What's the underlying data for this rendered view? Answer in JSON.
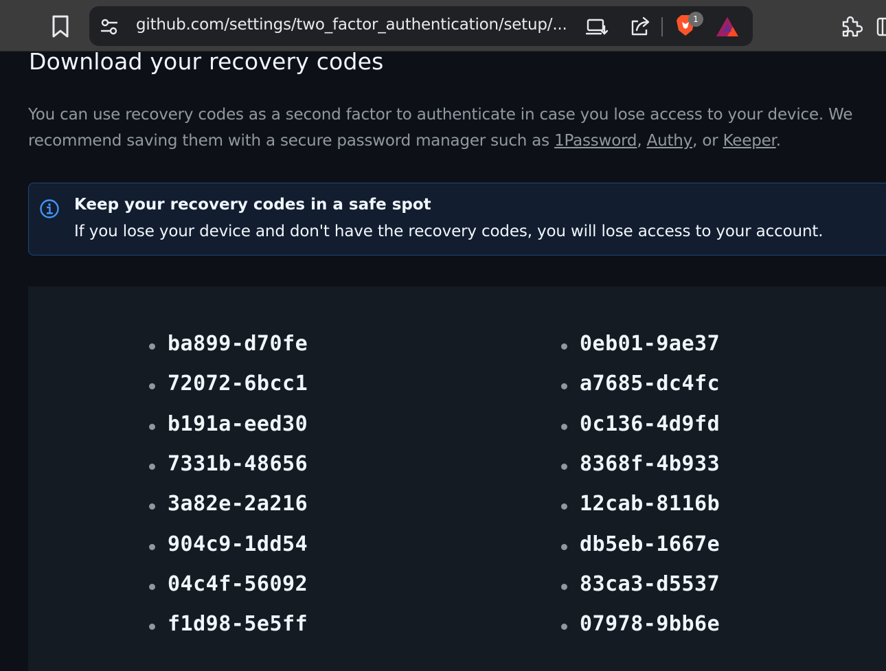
{
  "browser": {
    "url": "github.com/settings/two_factor_authentication/setup/...",
    "brave_badge_count": "1"
  },
  "page": {
    "title": "Download your recovery codes",
    "description_prefix": "You can use recovery codes as a second factor to authenticate in case you lose access to your device. We recommend saving them with a secure password manager such as ",
    "link_1password": "1Password",
    "sep1": ", ",
    "link_authy": "Authy",
    "sep2": ", or ",
    "link_keeper": "Keeper",
    "description_suffix": "."
  },
  "notice": {
    "title": "Keep your recovery codes in a safe spot",
    "body": "If you lose your device and don't have the recovery codes, you will lose access to your account."
  },
  "recovery_codes": [
    "ba899-d70fe",
    "72072-6bcc1",
    "b191a-eed30",
    "7331b-48656",
    "3a82e-2a216",
    "904c9-1dd54",
    "04c4f-56092",
    "f1d98-5e5ff",
    "0eb01-9ae37",
    "a7685-dc4fc",
    "0c136-4d9fd",
    "8368f-4b933",
    "12cab-8116b",
    "db5eb-1667e",
    "83ca3-d5537",
    "07978-9bb6e"
  ],
  "colors": {
    "page_bg": "#0d1117",
    "codes_bg": "#151b23",
    "accent_blue": "#4493f8",
    "muted_text": "#9198a1"
  }
}
